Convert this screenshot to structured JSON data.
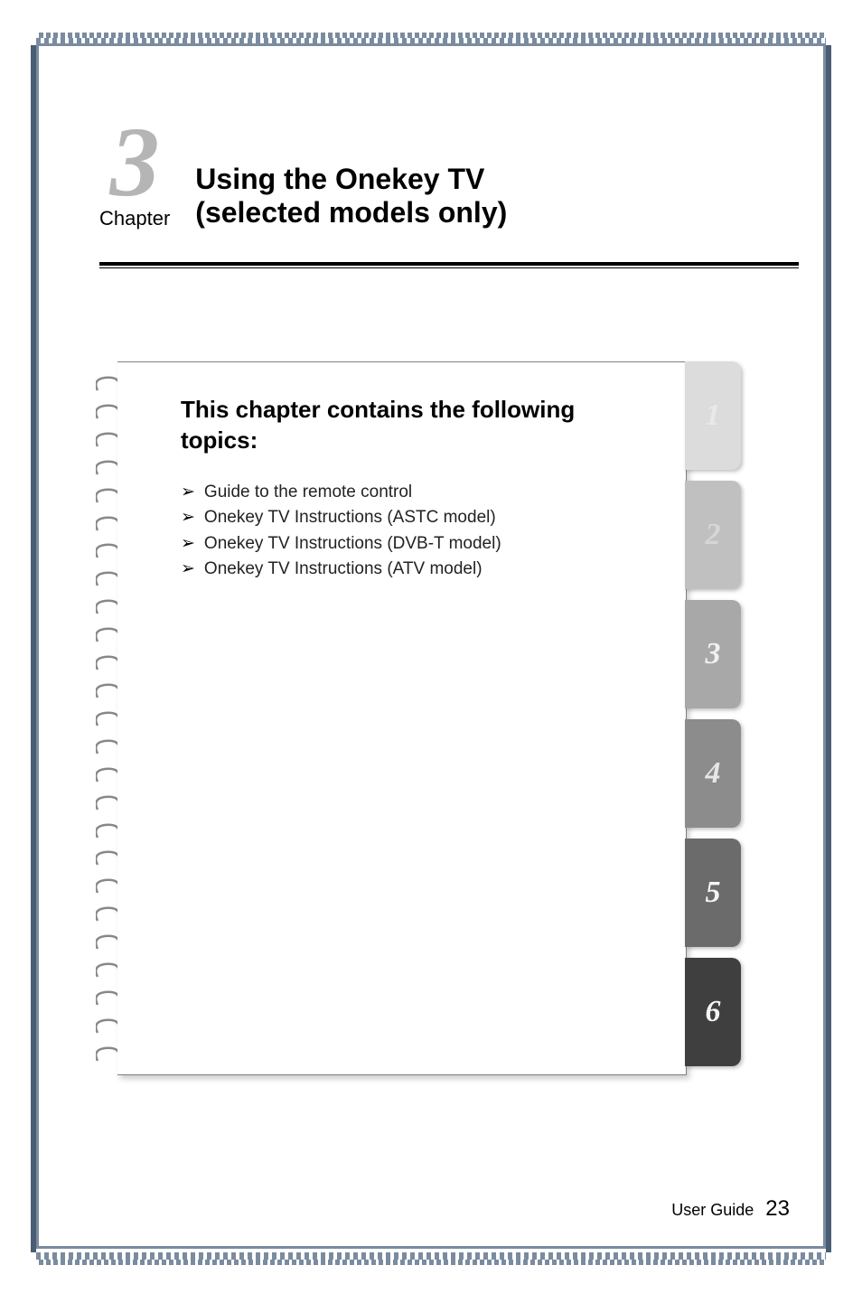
{
  "chapter": {
    "number": "3",
    "label": "Chapter",
    "title_line1": "Using the Onekey TV",
    "title_line2": "(selected models only)"
  },
  "topics": {
    "heading": "This chapter contains the following topics:",
    "items": [
      "Guide to the remote control",
      "Onekey TV Instructions (ASTC model)",
      "Onekey TV Instructions (DVB-T model)",
      "Onekey TV Instructions (ATV model)"
    ]
  },
  "tabs": [
    "1",
    "2",
    "3",
    "4",
    "5",
    "6"
  ],
  "footer": {
    "label": "User Guide",
    "page": "23"
  }
}
